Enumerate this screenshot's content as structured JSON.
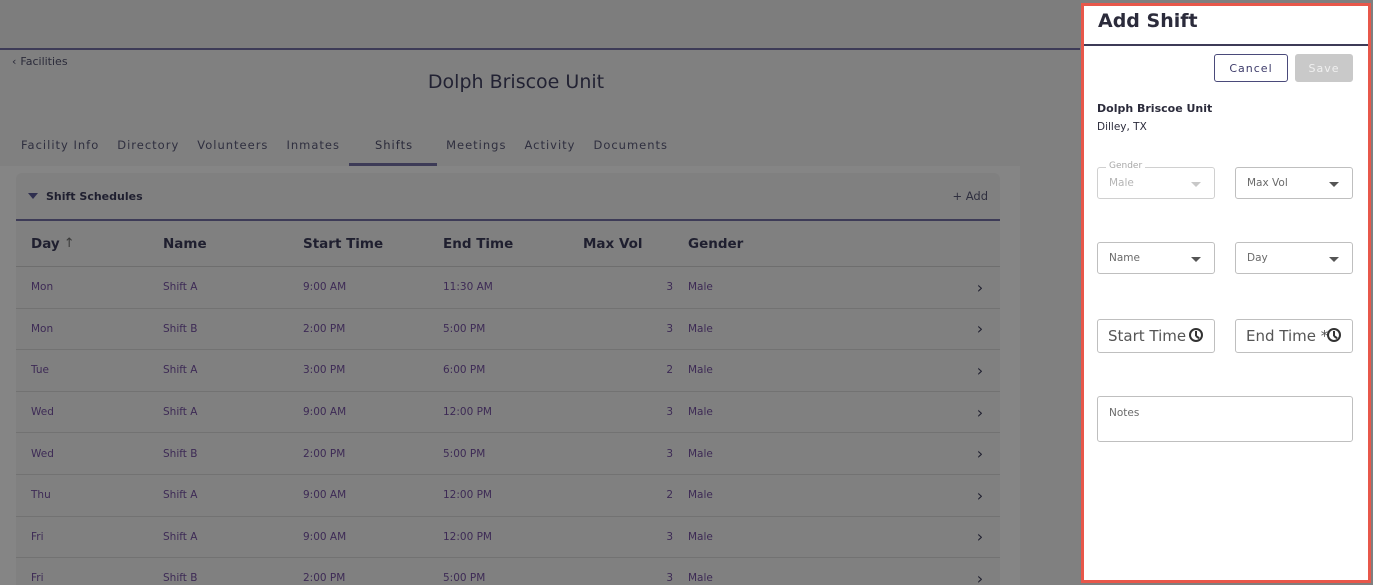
{
  "nav": {
    "back_label": "Facilities"
  },
  "facility": {
    "title": "Dolph Briscoe Unit"
  },
  "tabs": [
    {
      "label": "Facility Info"
    },
    {
      "label": "Directory"
    },
    {
      "label": "Volunteers"
    },
    {
      "label": "Inmates"
    },
    {
      "label": "Shifts"
    },
    {
      "label": "Meetings"
    },
    {
      "label": "Activity"
    },
    {
      "label": "Documents"
    }
  ],
  "active_tab": "Shifts",
  "schedule": {
    "title": "Shift Schedules",
    "add_label": "+ Add",
    "columns": {
      "day": "Day",
      "name": "Name",
      "start": "Start Time",
      "end": "End Time",
      "max": "Max Vol",
      "gender": "Gender"
    },
    "rows": [
      {
        "day": "Mon",
        "name": "Shift A",
        "start": "9:00 AM",
        "end": "11:30 AM",
        "max": "3",
        "gender": "Male"
      },
      {
        "day": "Mon",
        "name": "Shift B",
        "start": "2:00 PM",
        "end": "5:00 PM",
        "max": "3",
        "gender": "Male"
      },
      {
        "day": "Tue",
        "name": "Shift A",
        "start": "3:00 PM",
        "end": "6:00 PM",
        "max": "2",
        "gender": "Male"
      },
      {
        "day": "Wed",
        "name": "Shift A",
        "start": "9:00 AM",
        "end": "12:00 PM",
        "max": "3",
        "gender": "Male"
      },
      {
        "day": "Wed",
        "name": "Shift B",
        "start": "2:00 PM",
        "end": "5:00 PM",
        "max": "3",
        "gender": "Male"
      },
      {
        "day": "Thu",
        "name": "Shift A",
        "start": "9:00 AM",
        "end": "12:00 PM",
        "max": "2",
        "gender": "Male"
      },
      {
        "day": "Fri",
        "name": "Shift A",
        "start": "9:00 AM",
        "end": "12:00 PM",
        "max": "3",
        "gender": "Male"
      },
      {
        "day": "Fri",
        "name": "Shift B",
        "start": "2:00 PM",
        "end": "5:00 PM",
        "max": "3",
        "gender": "Male"
      }
    ]
  },
  "drawer": {
    "title": "Add Shift",
    "cancel_label": "Cancel",
    "save_label": "Save",
    "facility_name": "Dolph Briscoe Unit",
    "facility_location": "Dilley, TX",
    "gender_label": "Gender",
    "gender_value": "Male",
    "max_vol_placeholder": "Max Vol",
    "name_placeholder": "Name",
    "day_placeholder": "Day",
    "start_time_placeholder": "Start Time",
    "end_time_placeholder": "End Time *",
    "notes_placeholder": "Notes"
  },
  "colors": {
    "accent": "#3d3b57",
    "highlight_border": "#e8574a",
    "overlay": "#808080"
  }
}
